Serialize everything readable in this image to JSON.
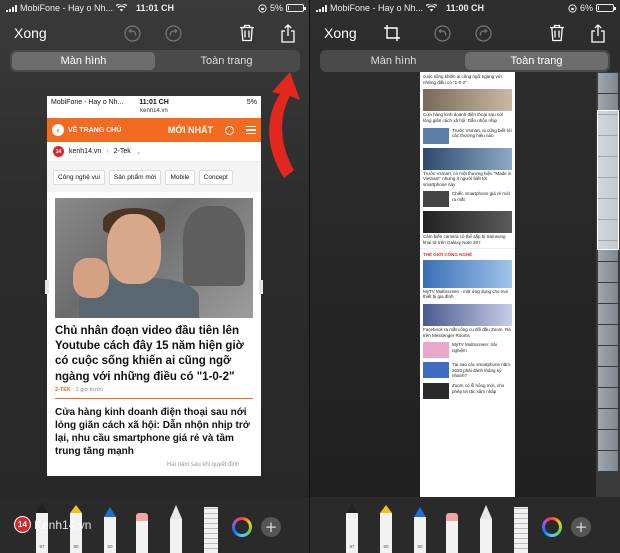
{
  "left": {
    "status": {
      "carrier": "MobiFone - Hay o Nh...",
      "time": "11:01 CH",
      "battery": "5%",
      "battery_level": 0.05
    },
    "toolbar": {
      "done_label": "Xong"
    },
    "segment": {
      "screen": "Màn hình",
      "full_page": "Toàn trang",
      "active": "screen"
    },
    "preview": {
      "status": {
        "carrier": "MobiFone - Hay o Nh...",
        "time": "11:01 CH",
        "battery": "5%"
      },
      "url": "kenh14.vn",
      "header": {
        "back_label": "VỀ TRANG CHỦ",
        "latest_label": "MỚI NHẤT"
      },
      "crumb": {
        "site": "kenh14.vn",
        "section": "2-Tek"
      },
      "chips": [
        "Công nghệ vui",
        "Sản phẩm mới",
        "Mobile",
        "Concept"
      ],
      "headline": "Chủ nhân đoạn video đầu tiên lên Youtube cách đây 15 năm hiện giờ có cuộc sống khiến ai cũng ngỡ ngàng với những điều có \"1-0-2\"",
      "meta_tag": "2-TEK",
      "meta_time": "· 2 giờ trước",
      "second_headline": "Cửa hàng kinh doanh điện thoại sau nới lỏng giãn cách xã hội: Dẫn nhộn nhịp trở lại, nhu cầu smartphone giá rẻ và tầm trung tăng mạnh",
      "cut_text": "Hai nǎm sau khi quyết định"
    },
    "watermark": {
      "logo": "14",
      "text": "Kenh14.vn"
    }
  },
  "right": {
    "status": {
      "carrier": "MobiFone - Hay o Nh...",
      "time": "11:00 CH",
      "battery": "6%",
      "battery_level": 0.06
    },
    "toolbar": {
      "done_label": "Xong"
    },
    "segment": {
      "screen": "Màn hình",
      "full_page": "Toàn trang",
      "active": "full_page"
    },
    "long": {
      "items_top": [
        {
          "text": "cuộc sống khiến ai cũng ngỡ ngàng với những điều có \"1-0-2\""
        },
        {
          "text": "Cửa hàng kinh doanh điện thoại sau nới lỏng giãn cách xã hội: Dẫn nhộn nhịp"
        },
        {
          "text": "Trước Vsmart, ai cũng biết tới các thương hiệu nào"
        },
        {
          "text": "Trước Vsmart, có một thương hiệu \"Made in Vietnam\" nhưng ít người biết tới smartphone này"
        },
        {
          "text": "Chiếc smartphone giá rẻ mới ra mắt"
        },
        {
          "text": "Cảm biến camera có thể sắp bị Samsung khai tử trên Galaxy Note 20?"
        }
      ],
      "section_title": "THẾ GIỚI CÔNG NGHỆ",
      "items_bottom": [
        {
          "text": "MyTV Multiscreen - một ứng dụng cho mọi thiết bị gia đình"
        },
        {
          "text": "Facebook ra mắt công cụ đối đầu Zoom. Rà trên Messenger Rooms"
        },
        {
          "text": "MyTV Multiscreen: trải nghiệm"
        },
        {
          "text": "Tại sao các smartphone năm 2020 phải đánh tháng ký nhanh?"
        },
        {
          "text": "Zoom có lỗ hổng mới, cho phép tin tặc xâm nhập"
        }
      ]
    }
  },
  "colors": {
    "accent_orange": "#f26b20",
    "kenh14_red": "#d9272e",
    "arrow_red": "#e0281f"
  },
  "icons": [
    "undo-icon",
    "redo-icon",
    "trash-icon",
    "share-icon",
    "crop-icon",
    "pen-icon",
    "marker-icon",
    "pencil-icon",
    "eraser-icon",
    "lasso-icon",
    "ruler-icon",
    "color-wheel-icon",
    "add-icon"
  ]
}
